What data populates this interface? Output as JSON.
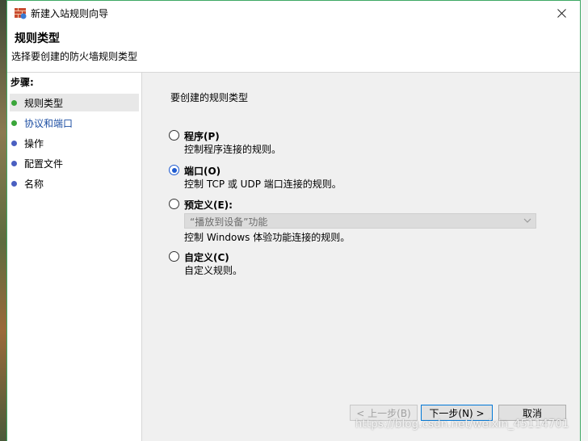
{
  "window": {
    "title": "新建入站规则向导",
    "close_glyph": "✕"
  },
  "header": {
    "title": "规则类型",
    "subtitle": "选择要创建的防火墙规则类型"
  },
  "steps": {
    "heading": "步骤:",
    "items": [
      {
        "label": "规则类型"
      },
      {
        "label": "协议和端口"
      },
      {
        "label": "操作"
      },
      {
        "label": "配置文件"
      },
      {
        "label": "名称"
      }
    ]
  },
  "content": {
    "prompt": "要创建的规则类型",
    "options": [
      {
        "label": "程序(P)",
        "description": "控制程序连接的规则。",
        "selected": false
      },
      {
        "label": "端口(O)",
        "description": "控制 TCP 或 UDP 端口连接的规则。",
        "selected": true
      },
      {
        "label": "预定义(E):",
        "description": "控制 Windows 体验功能连接的规则。",
        "selected": false
      },
      {
        "label": "自定义(C)",
        "description": "自定义规则。",
        "selected": false
      }
    ],
    "predefined_select_value": "“播放到设备”功能"
  },
  "buttons": {
    "back": "< 上一步(B)",
    "next": "下一步(N) >",
    "cancel": "取消"
  },
  "watermark": "https://blog.csdn.net/weixin_45114701",
  "colors": {
    "accent": "#0078d7",
    "radio_selected": "#1f5bd0",
    "step_done": "#3aa63a",
    "step_pending": "#4a5fc1",
    "window_border": "#3ea864"
  }
}
